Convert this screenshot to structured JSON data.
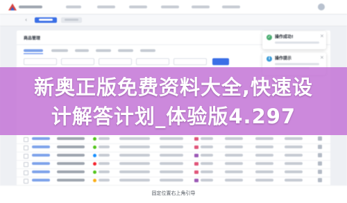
{
  "banner": {
    "line1": "新奥正版免费资料大全,快速设",
    "line2": "计解答计划_体验版4.297"
  },
  "caption": "固定位置右上角引导",
  "page": {
    "section_title": "商品管理"
  },
  "toasts": [
    {
      "type": "success",
      "title": "操作成功!",
      "icon": "check-circle-icon",
      "symbol": "✓",
      "color": "#4cae72"
    },
    {
      "type": "info",
      "title": "操作提示",
      "icon": "info-circle-icon",
      "symbol": "i",
      "color": "#3a9bd8"
    }
  ],
  "colors": {
    "accent": "#3b6fe6",
    "banner": "#c476d6",
    "page_bg": "#eef0f4"
  },
  "table": {
    "rows": [
      {
        "status_color": "#52c41a",
        "tag_color": "#e0567a"
      },
      {
        "status_color": "#52c41a",
        "tag_color": "#e0567a"
      },
      {
        "status_color": "#1890ff",
        "tag_color": "#9b59b6"
      },
      {
        "status_color": "#f5222d",
        "tag_color": "#e0567a"
      },
      {
        "status_color": "#52c41a",
        "tag_color": "#e0567a"
      },
      {
        "status_color": "#faad14",
        "tag_color": "#9b59b6"
      }
    ]
  }
}
